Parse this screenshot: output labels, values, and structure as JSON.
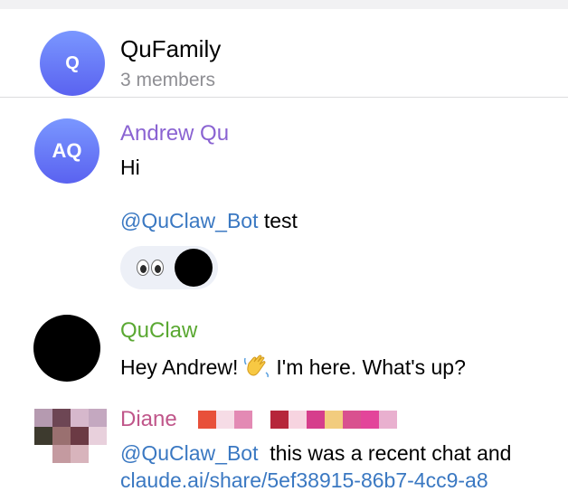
{
  "header": {
    "avatar_initial": "Q",
    "title": "QuFamily",
    "subtitle": "3 members"
  },
  "messages": [
    {
      "sender": "Andrew Qu",
      "sender_color": "#8a63d2",
      "avatar_initials": "AQ",
      "lines": [
        "Hi"
      ],
      "mention": "@QuClaw_Bot",
      "mention_text": " test",
      "reaction": {
        "icon": "eyes-emoji"
      }
    },
    {
      "sender": "QuClaw",
      "sender_color": "#5aa832",
      "text_before": "Hey Andrew!",
      "emoji": "waving-hand-emoji",
      "text_after": "I'm here. What's up?"
    },
    {
      "sender": "Diane",
      "sender_color": "#c0568a",
      "mention": "@QuClaw_Bot",
      "text": "  this was a recent chat and",
      "link": "claude.ai/share/5ef38915-86b7-4cc9-a8"
    }
  ],
  "colors": {
    "mention": "#3a78c2",
    "avatar_gradient_top": "#7a97ff",
    "avatar_gradient_bottom": "#5a62f0",
    "reaction_bg": "#edf0f7"
  }
}
